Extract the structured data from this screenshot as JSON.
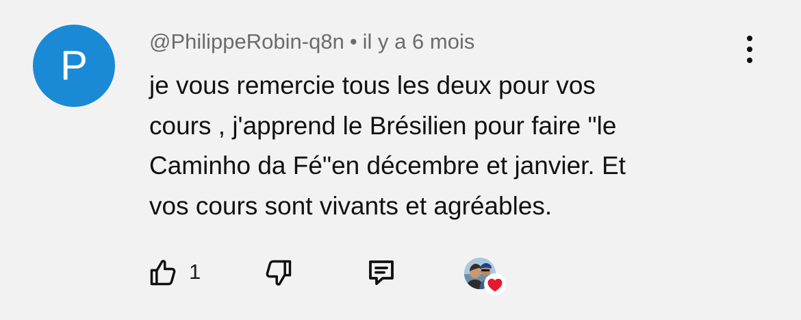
{
  "comment": {
    "avatar_letter": "P",
    "author": "@PhilippeRobin-q8n",
    "separator": "•",
    "timestamp": "il y a 6 mois",
    "text": "je vous remercie tous les deux pour vos\ncours , j'apprend le Brésilien pour faire \"le\nCaminho da Fé\"en décembre et janvier. Et\nvos cours sont vivants et agréables.",
    "like_count": "1"
  },
  "icons": {
    "more": "more-vertical-icon",
    "like": "thumbs-up-icon",
    "dislike": "thumbs-down-icon",
    "reply": "reply-comment-icon",
    "creator_heart": "creator-heart-icon"
  },
  "colors": {
    "background": "#f2f2f2",
    "avatar": "#1a8ad6",
    "meta_text": "#6b6b6b",
    "heart": "#e8192c"
  }
}
